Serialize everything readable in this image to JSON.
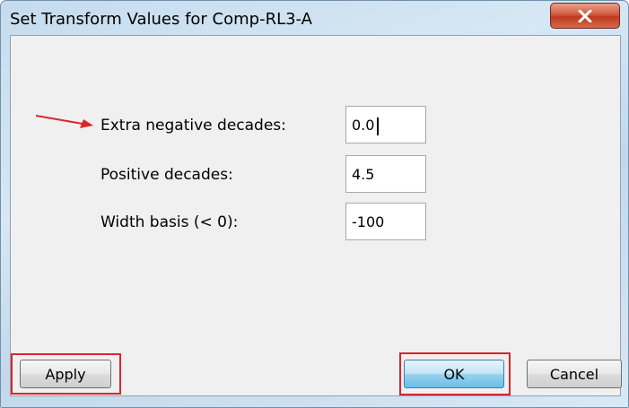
{
  "window": {
    "title": "Set Transform Values for Comp-RL3-A",
    "close_icon": "close-icon"
  },
  "fields": [
    {
      "label": "Extra negative decades:",
      "value": "0.0"
    },
    {
      "label": "Positive decades:",
      "value": "4.5"
    },
    {
      "label": "Width basis (< 0):",
      "value": "-100"
    }
  ],
  "buttons": {
    "apply": "Apply",
    "ok": "OK",
    "cancel": "Cancel"
  },
  "annotations": {
    "color": "#d8262c",
    "arrow_target": "Extra negative decades:",
    "highlighted_buttons": [
      "Apply",
      "OK"
    ]
  }
}
